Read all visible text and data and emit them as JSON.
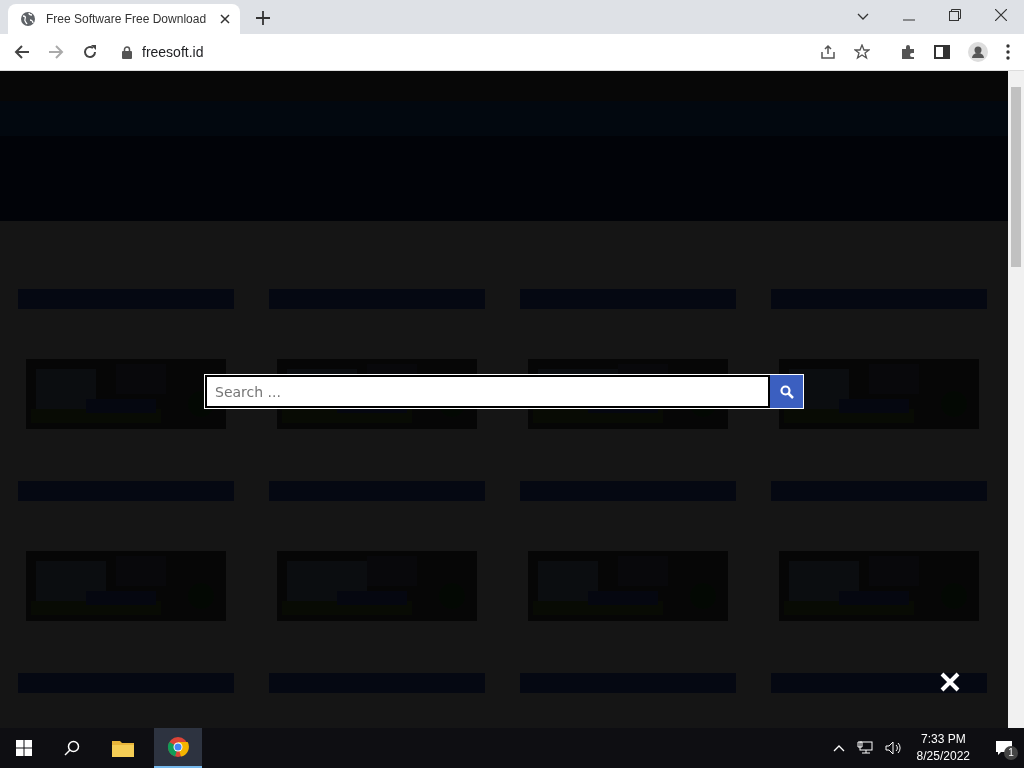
{
  "browser": {
    "tab": {
      "title": "Free Software Free Download",
      "selected": true
    },
    "url": "freesoft.id"
  },
  "page": {
    "posts": [
      {
        "kind": "picture"
      },
      {
        "kind": "picture"
      },
      {
        "kind": "picture"
      },
      {
        "kind": "picture"
      },
      {
        "kind": "picture"
      },
      {
        "kind": "picture"
      },
      {
        "kind": "picture"
      },
      {
        "kind": "picture"
      },
      {
        "kind": "bar"
      },
      {
        "kind": "bar"
      },
      {
        "kind": "bar"
      },
      {
        "kind": "bar"
      }
    ]
  },
  "search": {
    "placeholder": "Search ..."
  },
  "taskbar": {
    "time": "7:33 PM",
    "date": "8/25/2022",
    "notification_count": "1"
  }
}
